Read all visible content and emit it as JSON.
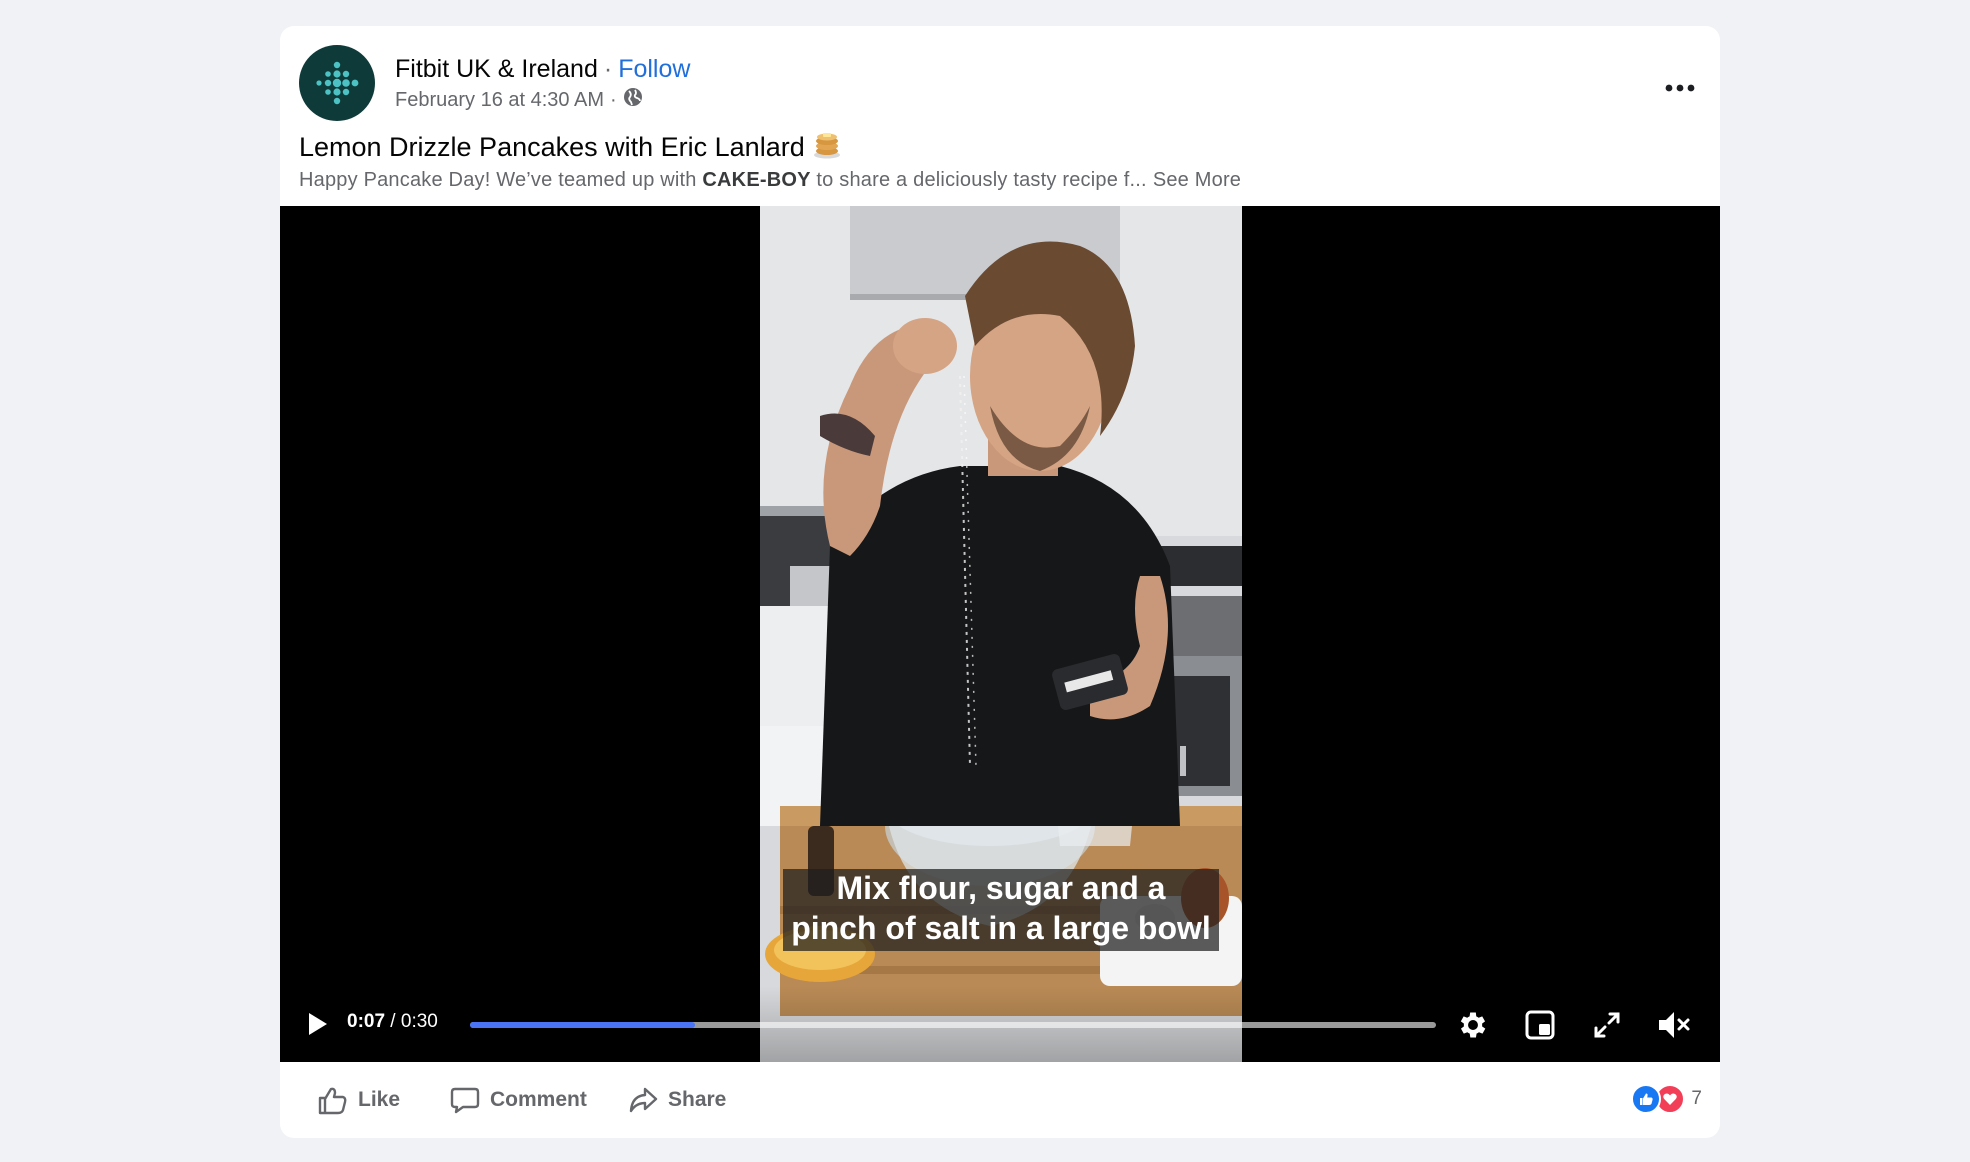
{
  "post": {
    "page_name": "Fitbit UK & Ireland",
    "separator": "·",
    "follow_label": "Follow",
    "timestamp": "February 16 at 4:30 AM",
    "meta_separator": "·",
    "privacy_icon": "globe-icon",
    "more_icon": "ellipsis-icon",
    "title": "Lemon Drizzle Pancakes with Eric Lanlard",
    "title_emoji": "pancakes-emoji",
    "text_before": "Happy Pancake Day! We’ve teamed up with ",
    "text_brand": "CAKE-BOY",
    "text_after": " to share a deliciously tasty recipe f...",
    "see_more_label": "See More"
  },
  "video": {
    "caption_line1": "Mix flour, sugar and a",
    "caption_line2": "pinch of salt in a large bowl",
    "current_time": "0:07",
    "time_separator": " / ",
    "duration": "0:30",
    "progress_fraction": 0.233,
    "progress_color": "#4a74f5",
    "icons": [
      "play-icon",
      "settings-icon",
      "picture-in-picture-icon",
      "fullscreen-icon",
      "muted-icon"
    ]
  },
  "actions": {
    "like_label": "Like",
    "comment_label": "Comment",
    "share_label": "Share",
    "reaction_count": "7",
    "reaction_icons": [
      "like-reaction-icon",
      "love-reaction-icon"
    ]
  },
  "colors": {
    "background": "#f0f2f5",
    "link_blue": "#216fdb",
    "secondary_text": "#65676b",
    "avatar_bg": "#0e3b39",
    "fitbit_teal": "#4cc2c4"
  }
}
